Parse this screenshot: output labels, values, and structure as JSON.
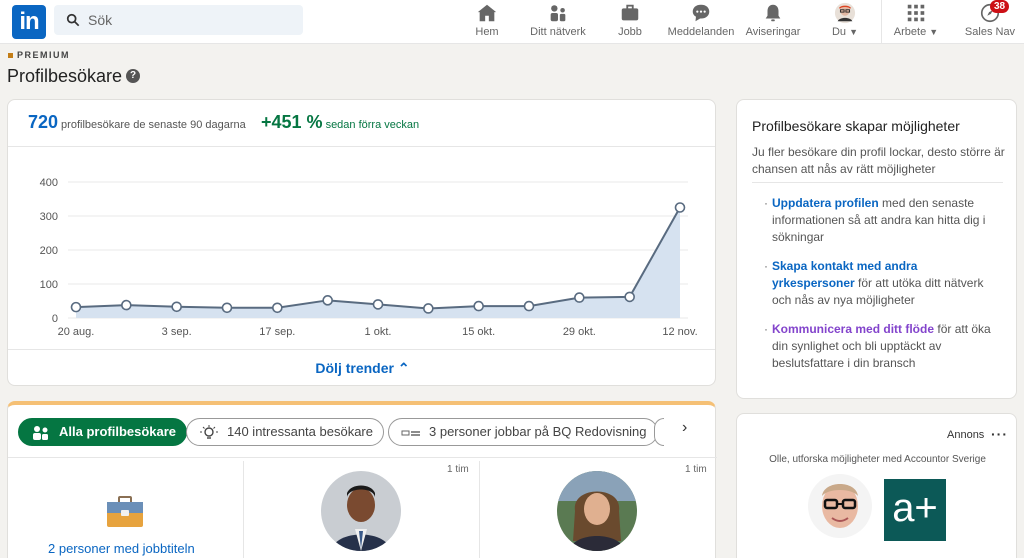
{
  "nav": {
    "logo_text": "in",
    "search_placeholder": "Sök",
    "items": [
      {
        "label": "Hem",
        "icon": "home-icon"
      },
      {
        "label": "Ditt nätverk",
        "icon": "network-icon"
      },
      {
        "label": "Jobb",
        "icon": "briefcase-icon"
      },
      {
        "label": "Meddelanden",
        "icon": "messaging-icon"
      },
      {
        "label": "Aviseringar",
        "icon": "bell-icon"
      },
      {
        "label": "Du",
        "icon": "profile-avatar"
      },
      {
        "label": "Arbete",
        "icon": "grid-icon"
      },
      {
        "label": "Sales Nav",
        "icon": "compass-icon"
      }
    ],
    "sales_nav_badge": "38"
  },
  "header": {
    "premium_label": "PREMIUM",
    "title": "Profilbesökare"
  },
  "stats": {
    "visitors_count": "720",
    "visitors_label": "profilbesökare de senaste 90 dagarna",
    "change_value": "+451 %",
    "change_label": "sedan förra veckan"
  },
  "chart_data": {
    "type": "area",
    "x_ticks": [
      "20 aug.",
      "3 sep.",
      "17 sep.",
      "1 okt.",
      "15 okt.",
      "29 okt.",
      "12 nov."
    ],
    "y_ticks": [
      "0",
      "100",
      "200",
      "300",
      "400"
    ],
    "ylim": [
      0,
      400
    ],
    "values": [
      32,
      38,
      33,
      30,
      30,
      52,
      40,
      28,
      35,
      35,
      60,
      62,
      325
    ],
    "color": "#596b80",
    "fill": "#d6e2f0"
  },
  "trend_toggle": "Dölj trender",
  "info": {
    "title": "Profilbesökare skapar möjligheter",
    "subtitle": "Ju fler besökare din profil lockar, desto större är chansen att nås av rätt möjligheter",
    "items": [
      {
        "link": "Uppdatera profilen",
        "text": " med den senaste informationen så att andra kan hitta dig i sökningar"
      },
      {
        "link": "Skapa kontakt med andra yrkespersoner",
        "text": " för att utöka ditt nätverk och nås av nya möjligheter"
      },
      {
        "link": "Kommunicera med ditt flöde",
        "text": " för att öka din synlighet och bli upptäckt av beslutsfattare i din bransch"
      }
    ]
  },
  "filters": {
    "all": "Alla profilbesökare",
    "interesting": "140 intressanta besökare",
    "company": "3 personer jobbar på BQ Redovisning"
  },
  "visitors": {
    "jobs_link": "2 personer med jobbtiteln",
    "time1": "1 tim",
    "time2": "1 tim"
  },
  "ad": {
    "label": "Annons",
    "text": "Olle, utforska möjligheter med Accountor Sverige",
    "logo_text": "a+"
  }
}
